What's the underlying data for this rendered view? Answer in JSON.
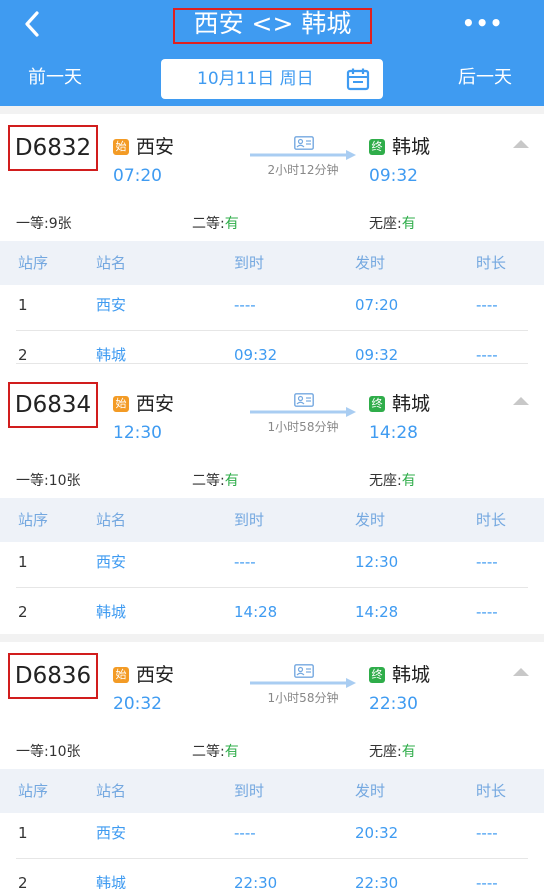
{
  "header": {
    "title": "西安 <> 韩城",
    "prev_day": "前一天",
    "next_day": "后一天",
    "date": "10月11日 周日"
  },
  "table_headers": [
    "站序",
    "站名",
    "到时",
    "发时",
    "时长"
  ],
  "seat_labels": {
    "first": "一等:",
    "second": "二等:",
    "none": "无座:"
  },
  "trains": [
    {
      "number": "D6832",
      "start_badge": "始",
      "end_badge": "终",
      "from": "西安",
      "to": "韩城",
      "depart": "07:20",
      "arrive": "09:32",
      "duration": "2小时12分钟",
      "first_class": "9张",
      "second_class": "有",
      "no_seat": "有",
      "stops": [
        {
          "seq": "1",
          "name": "西安",
          "arr": "----",
          "dep": "07:20",
          "dur": "----"
        },
        {
          "seq": "2",
          "name": "韩城",
          "arr": "09:32",
          "dep": "09:32",
          "dur": "----"
        }
      ]
    },
    {
      "number": "D6834",
      "start_badge": "始",
      "end_badge": "终",
      "from": "西安",
      "to": "韩城",
      "depart": "12:30",
      "arrive": "14:28",
      "duration": "1小时58分钟",
      "first_class": "10张",
      "second_class": "有",
      "no_seat": "有",
      "stops": [
        {
          "seq": "1",
          "name": "西安",
          "arr": "----",
          "dep": "12:30",
          "dur": "----"
        },
        {
          "seq": "2",
          "name": "韩城",
          "arr": "14:28",
          "dep": "14:28",
          "dur": "----"
        }
      ]
    },
    {
      "number": "D6836",
      "start_badge": "始",
      "end_badge": "终",
      "from": "西安",
      "to": "韩城",
      "depart": "20:32",
      "arrive": "22:30",
      "duration": "1小时58分钟",
      "first_class": "10张",
      "second_class": "有",
      "no_seat": "有",
      "stops": [
        {
          "seq": "1",
          "name": "西安",
          "arr": "----",
          "dep": "20:32",
          "dur": "----"
        },
        {
          "seq": "2",
          "name": "韩城",
          "arr": "22:30",
          "dep": "22:30",
          "dur": "----"
        }
      ]
    }
  ],
  "icons": {
    "back": "back-chevron-icon",
    "more": "more-dots-icon",
    "calendar": "calendar-icon",
    "ticket": "id-card-icon",
    "arrow": "route-arrow-icon",
    "collapse": "collapse-caret-icon"
  },
  "colors": {
    "header_bg": "#3f9bf1",
    "accent_blue": "#3f9bf1",
    "available_green": "#2fad4a",
    "start_badge": "#f39b25",
    "end_badge": "#2fad4a",
    "highlight_red": "#e02020"
  }
}
